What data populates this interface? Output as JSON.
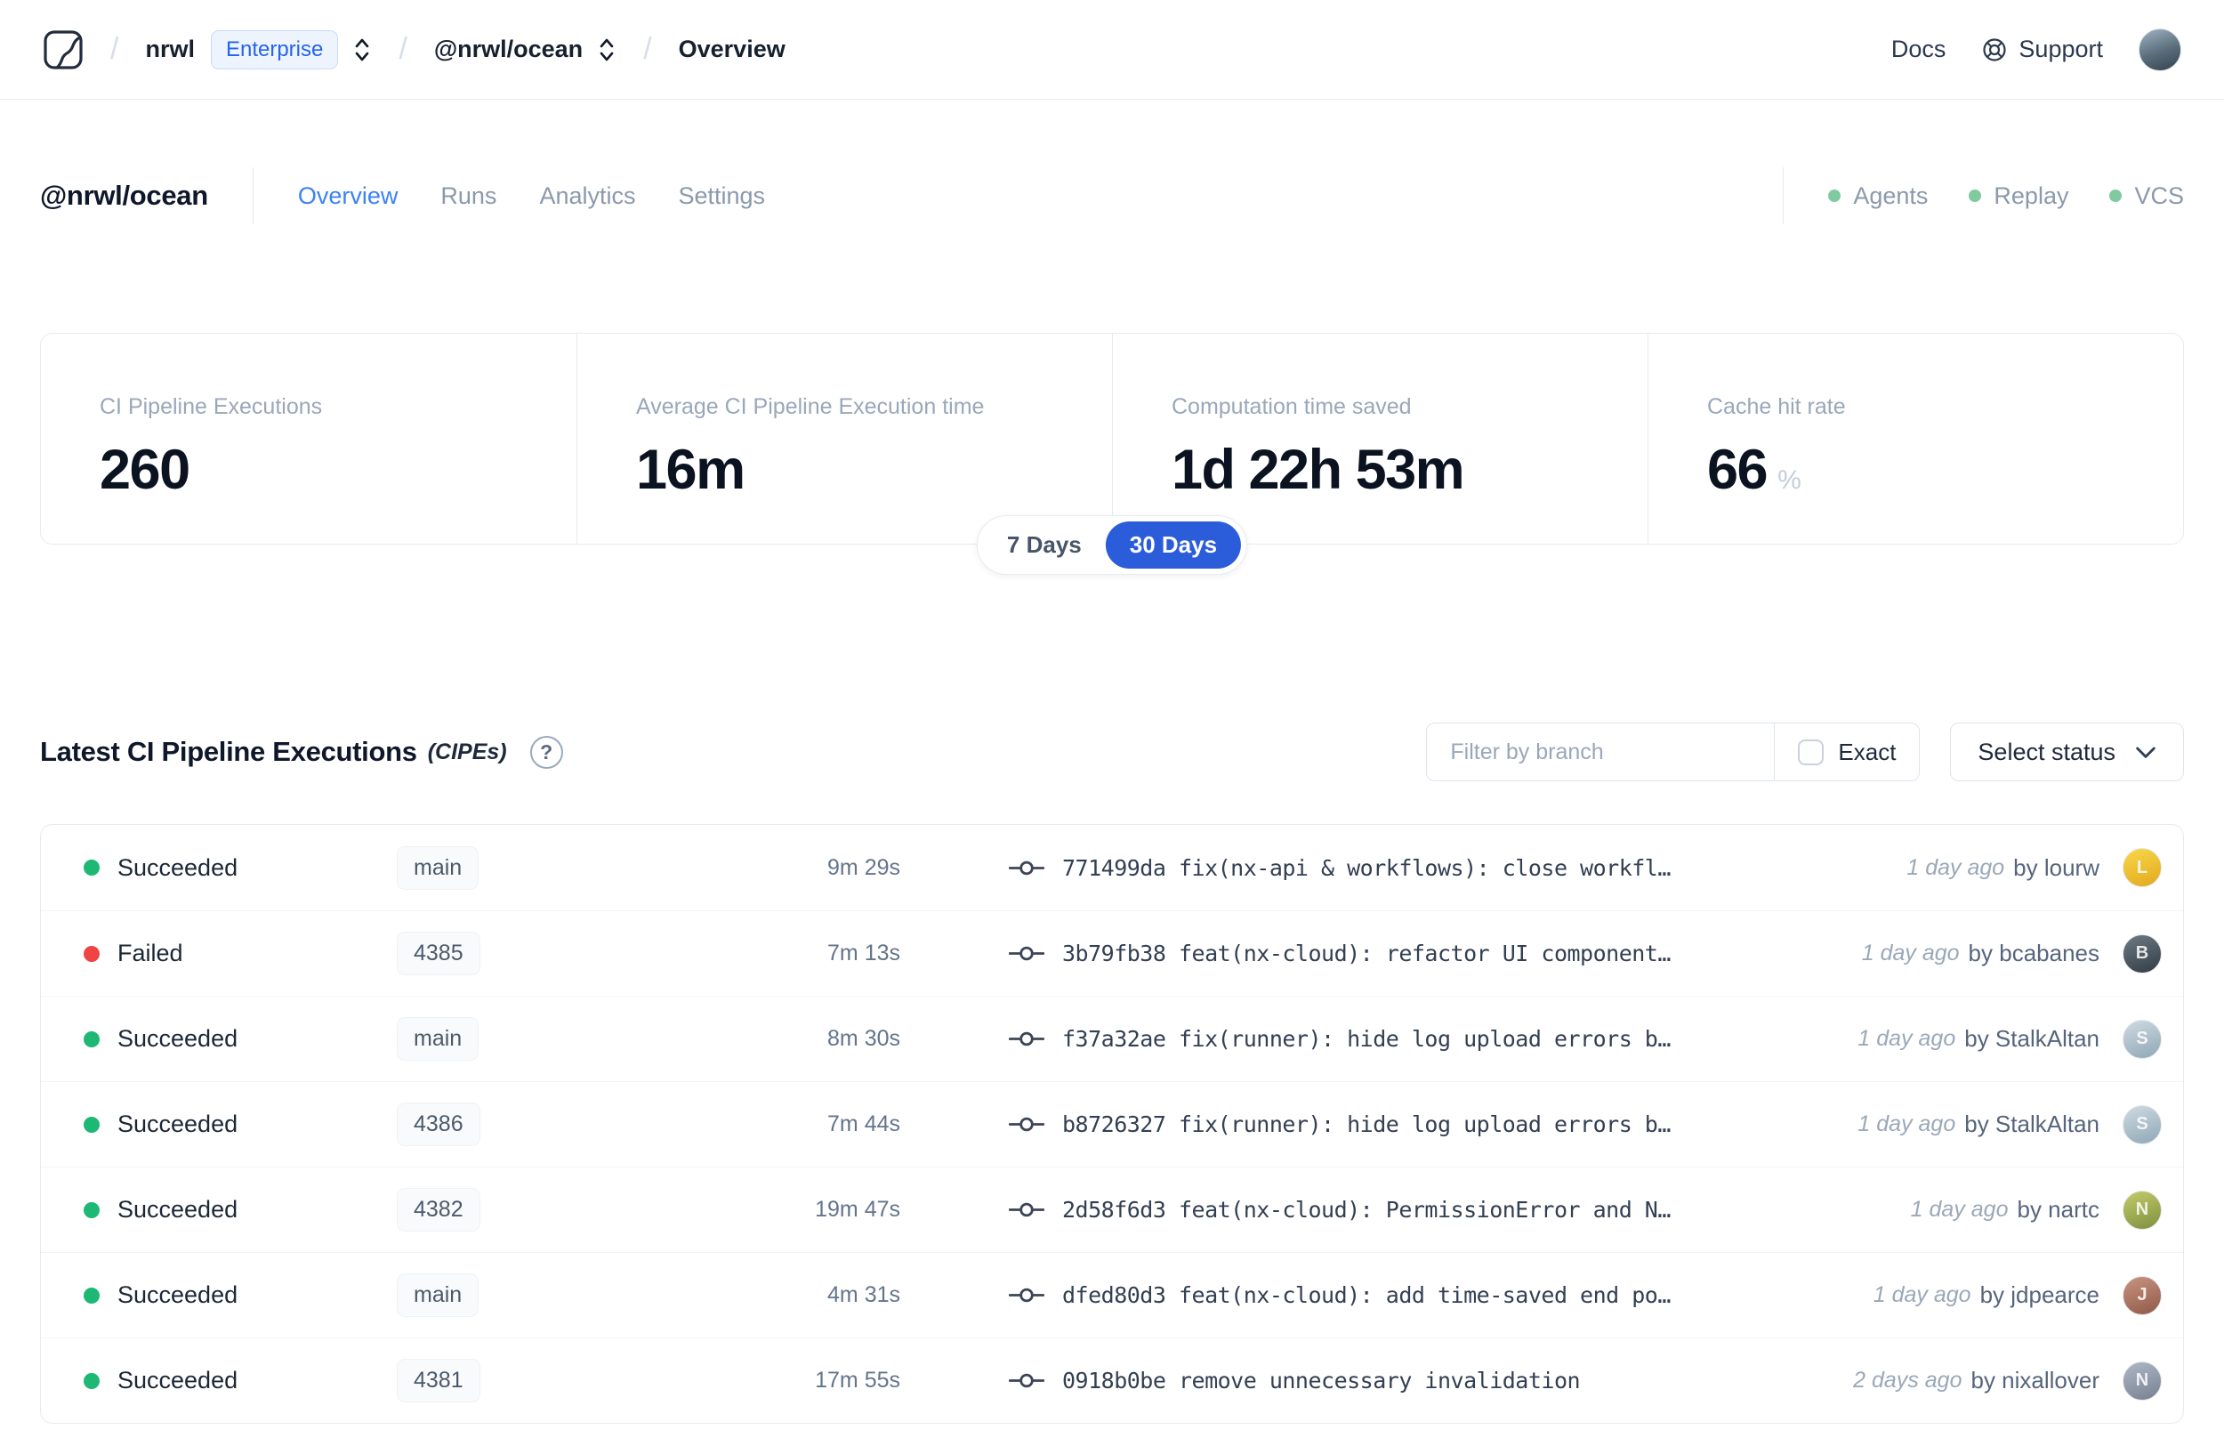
{
  "colors": {
    "accent_blue": "#2563eb",
    "active_tab_blue": "#3b82f6",
    "pill_blue": "#2b5cd9",
    "success_green": "#1db873",
    "failed_red": "#ef4444",
    "indicator_green": "#7fca9f"
  },
  "nav": {
    "separator": "/",
    "org": "nrwl",
    "org_badge": "Enterprise",
    "workspace": "@nrwl/ocean",
    "page": "Overview",
    "docs_label": "Docs",
    "support_label": "Support",
    "icons": {
      "logo": "nx-cloud-logo",
      "org_switcher": "chevron-up-down-icon",
      "workspace_switcher": "chevron-up-down-icon",
      "support": "lifebuoy-icon",
      "avatar": "user-avatar"
    }
  },
  "header": {
    "title": "@nrwl/ocean",
    "tabs": [
      {
        "label": "Overview",
        "active": true
      },
      {
        "label": "Runs",
        "active": false
      },
      {
        "label": "Analytics",
        "active": false
      },
      {
        "label": "Settings",
        "active": false
      }
    ],
    "indicators": [
      {
        "label": "Agents"
      },
      {
        "label": "Replay"
      },
      {
        "label": "VCS"
      }
    ]
  },
  "stats": {
    "cards": [
      {
        "label": "CI Pipeline Executions",
        "value": "260",
        "suffix": ""
      },
      {
        "label": "Average CI Pipeline Execution time",
        "value": "16m",
        "suffix": ""
      },
      {
        "label": "Computation time saved",
        "value": "1d 22h 53m",
        "suffix": ""
      },
      {
        "label": "Cache hit rate",
        "value": "66",
        "suffix": "%"
      }
    ],
    "range_toggle": {
      "options": [
        {
          "label": "7 Days",
          "selected": false
        },
        {
          "label": "30 Days",
          "selected": true
        }
      ]
    }
  },
  "section": {
    "title": "Latest CI Pipeline Executions",
    "title_suffix": "(CIPEs)",
    "help_icon": "?",
    "filter_placeholder": "Filter by branch",
    "exact_label": "Exact",
    "status_select_label": "Select status"
  },
  "table": {
    "rows": [
      {
        "status": "Succeeded",
        "status_color": "#1db873",
        "branch": "main",
        "duration": "9m 29s",
        "commit_hash": "771499da",
        "commit_message": "fix(nx-api & workflows): close workfl…",
        "time_ago": "1 day ago",
        "author": "by lourw",
        "avatar_initial": "L",
        "avatar_color_a": "#f8d84a",
        "avatar_color_b": "#e3a81c"
      },
      {
        "status": "Failed",
        "status_color": "#ef4444",
        "branch": "4385",
        "duration": "7m 13s",
        "commit_hash": "3b79fb38",
        "commit_message": "feat(nx-cloud): refactor UI component…",
        "time_ago": "1 day ago",
        "author": "by bcabanes",
        "avatar_initial": "B",
        "avatar_color_a": "#6d7a85",
        "avatar_color_b": "#323c44"
      },
      {
        "status": "Succeeded",
        "status_color": "#1db873",
        "branch": "main",
        "duration": "8m 30s",
        "commit_hash": "f37a32ae",
        "commit_message": "fix(runner): hide log upload errors b…",
        "time_ago": "1 day ago",
        "author": "by StalkAltan",
        "avatar_initial": "S",
        "avatar_color_a": "#cfdbe2",
        "avatar_color_b": "#8fa7b5"
      },
      {
        "status": "Succeeded",
        "status_color": "#1db873",
        "branch": "4386",
        "duration": "7m 44s",
        "commit_hash": "b8726327",
        "commit_message": "fix(runner): hide log upload errors b…",
        "time_ago": "1 day ago",
        "author": "by StalkAltan",
        "avatar_initial": "S",
        "avatar_color_a": "#cfdbe2",
        "avatar_color_b": "#8fa7b5"
      },
      {
        "status": "Succeeded",
        "status_color": "#1db873",
        "branch": "4382",
        "duration": "19m 47s",
        "commit_hash": "2d58f6d3",
        "commit_message": "feat(nx-cloud): PermissionError and N…",
        "time_ago": "1 day ago",
        "author": "by nartc",
        "avatar_initial": "N",
        "avatar_color_a": "#c3cc6a",
        "avatar_color_b": "#7e8f3e"
      },
      {
        "status": "Succeeded",
        "status_color": "#1db873",
        "branch": "main",
        "duration": "4m 31s",
        "commit_hash": "dfed80d3",
        "commit_message": "feat(nx-cloud): add time-saved end po…",
        "time_ago": "1 day ago",
        "author": "by jdpearce",
        "avatar_initial": "J",
        "avatar_color_a": "#c99582",
        "avatar_color_b": "#8e5a47"
      },
      {
        "status": "Succeeded",
        "status_color": "#1db873",
        "branch": "4381",
        "duration": "17m 55s",
        "commit_hash": "0918b0be",
        "commit_message": "remove unnecessary invalidation",
        "time_ago": "2 days ago",
        "author": "by nixallover",
        "avatar_initial": "N",
        "avatar_color_a": "#aeb8c6",
        "avatar_color_b": "#76808f"
      }
    ]
  }
}
